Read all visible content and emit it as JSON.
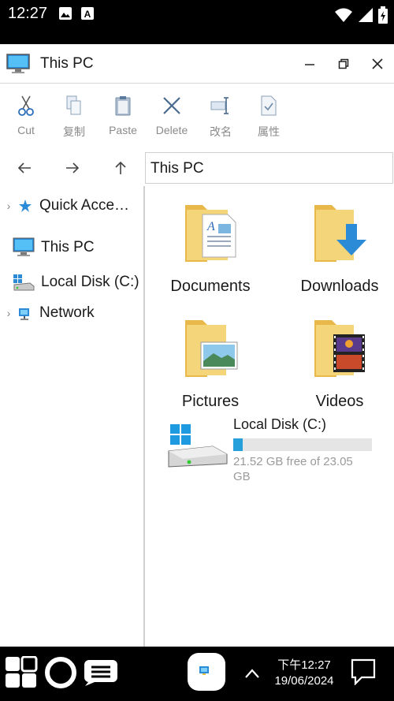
{
  "status_bar": {
    "time": "12:27",
    "icons": [
      "photo-icon",
      "a-icon",
      "wifi-icon",
      "signal-icon",
      "battery-icon"
    ]
  },
  "window": {
    "title": "This PC",
    "icon": "computer-icon",
    "controls": [
      "minimize-icon",
      "restore-icon",
      "close-icon"
    ]
  },
  "toolbar": [
    {
      "label": "Cut",
      "icon": "scissors-icon"
    },
    {
      "label": "复制",
      "icon": "copy-icon"
    },
    {
      "label": "Paste",
      "icon": "paste-icon"
    },
    {
      "label": "Delete",
      "icon": "delete-icon"
    },
    {
      "label": "改名",
      "icon": "rename-icon"
    },
    {
      "label": "属性",
      "icon": "properties-icon"
    }
  ],
  "nav": {
    "address": "This PC"
  },
  "sidebar": [
    {
      "label": "Quick Acce…",
      "icon": "star-icon",
      "expandable": true
    },
    {
      "label": "This PC",
      "icon": "computer-icon",
      "expandable": false
    },
    {
      "label": "Local Disk (C:)",
      "icon": "drive-icon",
      "expandable": false
    },
    {
      "label": "Network",
      "icon": "network-icon",
      "expandable": true
    }
  ],
  "folders": [
    {
      "label": "Documents",
      "icon": "documents-folder-icon"
    },
    {
      "label": "Downloads",
      "icon": "downloads-folder-icon"
    },
    {
      "label": "Pictures",
      "icon": "pictures-folder-icon"
    },
    {
      "label": "Videos",
      "icon": "videos-folder-icon"
    }
  ],
  "disk": {
    "label": "Local Disk (C:)",
    "free_text": "21.52 GB free of 23.05 GB",
    "used_fraction": 0.066,
    "bar_color": "#26a0da"
  },
  "taskbar": {
    "time": "下午12:27",
    "date": "19/06/2024"
  },
  "colors": {
    "accent": "#26a0da",
    "folder": "#f5d57a"
  }
}
